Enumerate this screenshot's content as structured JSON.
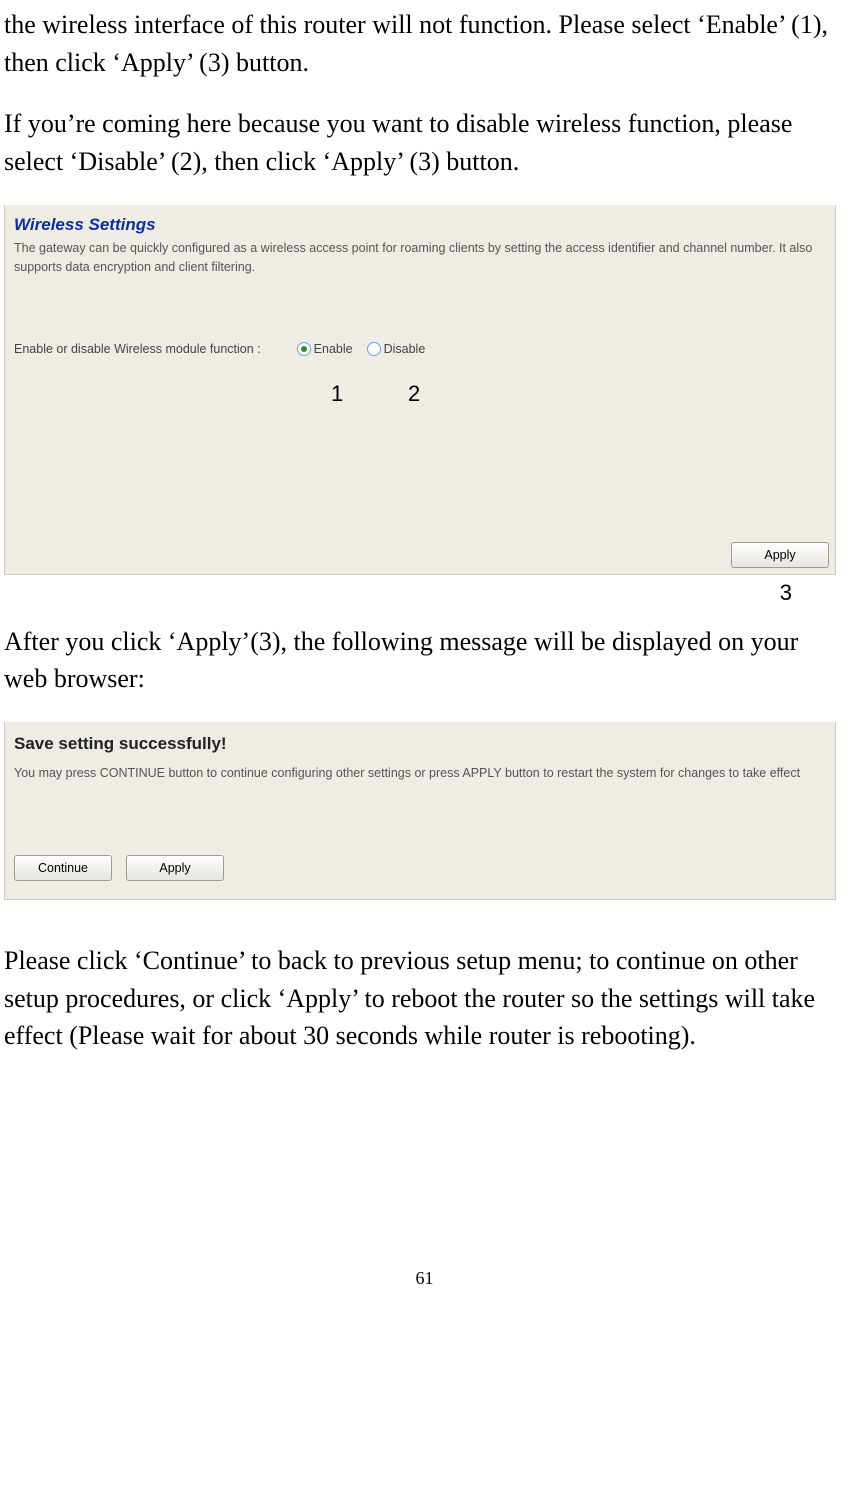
{
  "doc": {
    "para1": "the wireless interface of this router will not function. Please select ‘Enable’ (1), then click ‘Apply’ (3) button.",
    "para2": "If you’re coming here because you want to disable wireless function, please select ‘Disable’ (2), then click ‘Apply’ (3) button.",
    "para3": "After you click ‘Apply’(3), the following message will be displayed on your web browser:",
    "para4": "Please click ‘Continue’ to back to previous setup menu; to continue on other setup procedures, or click ‘Apply’ to reboot the router so the settings will take effect (Please wait for about 30 seconds while router is rebooting).",
    "page_number": "61"
  },
  "panel1": {
    "title": "Wireless Settings",
    "subtitle": "The gateway can be quickly configured as a wireless access point for roaming clients by setting the access identifier and channel number. It also supports data encryption and client filtering.",
    "label": "Enable or disable Wireless module function :",
    "radio_enable": "Enable",
    "radio_disable": "Disable",
    "apply": "Apply",
    "annot1": "1",
    "annot2": "2",
    "annot3": "3"
  },
  "panel2": {
    "title": "Save setting successfully!",
    "subtitle": "You may press CONTINUE button to continue configuring other settings or press APPLY button to restart the system for changes to take effect",
    "continue": "Continue",
    "apply": "Apply"
  }
}
